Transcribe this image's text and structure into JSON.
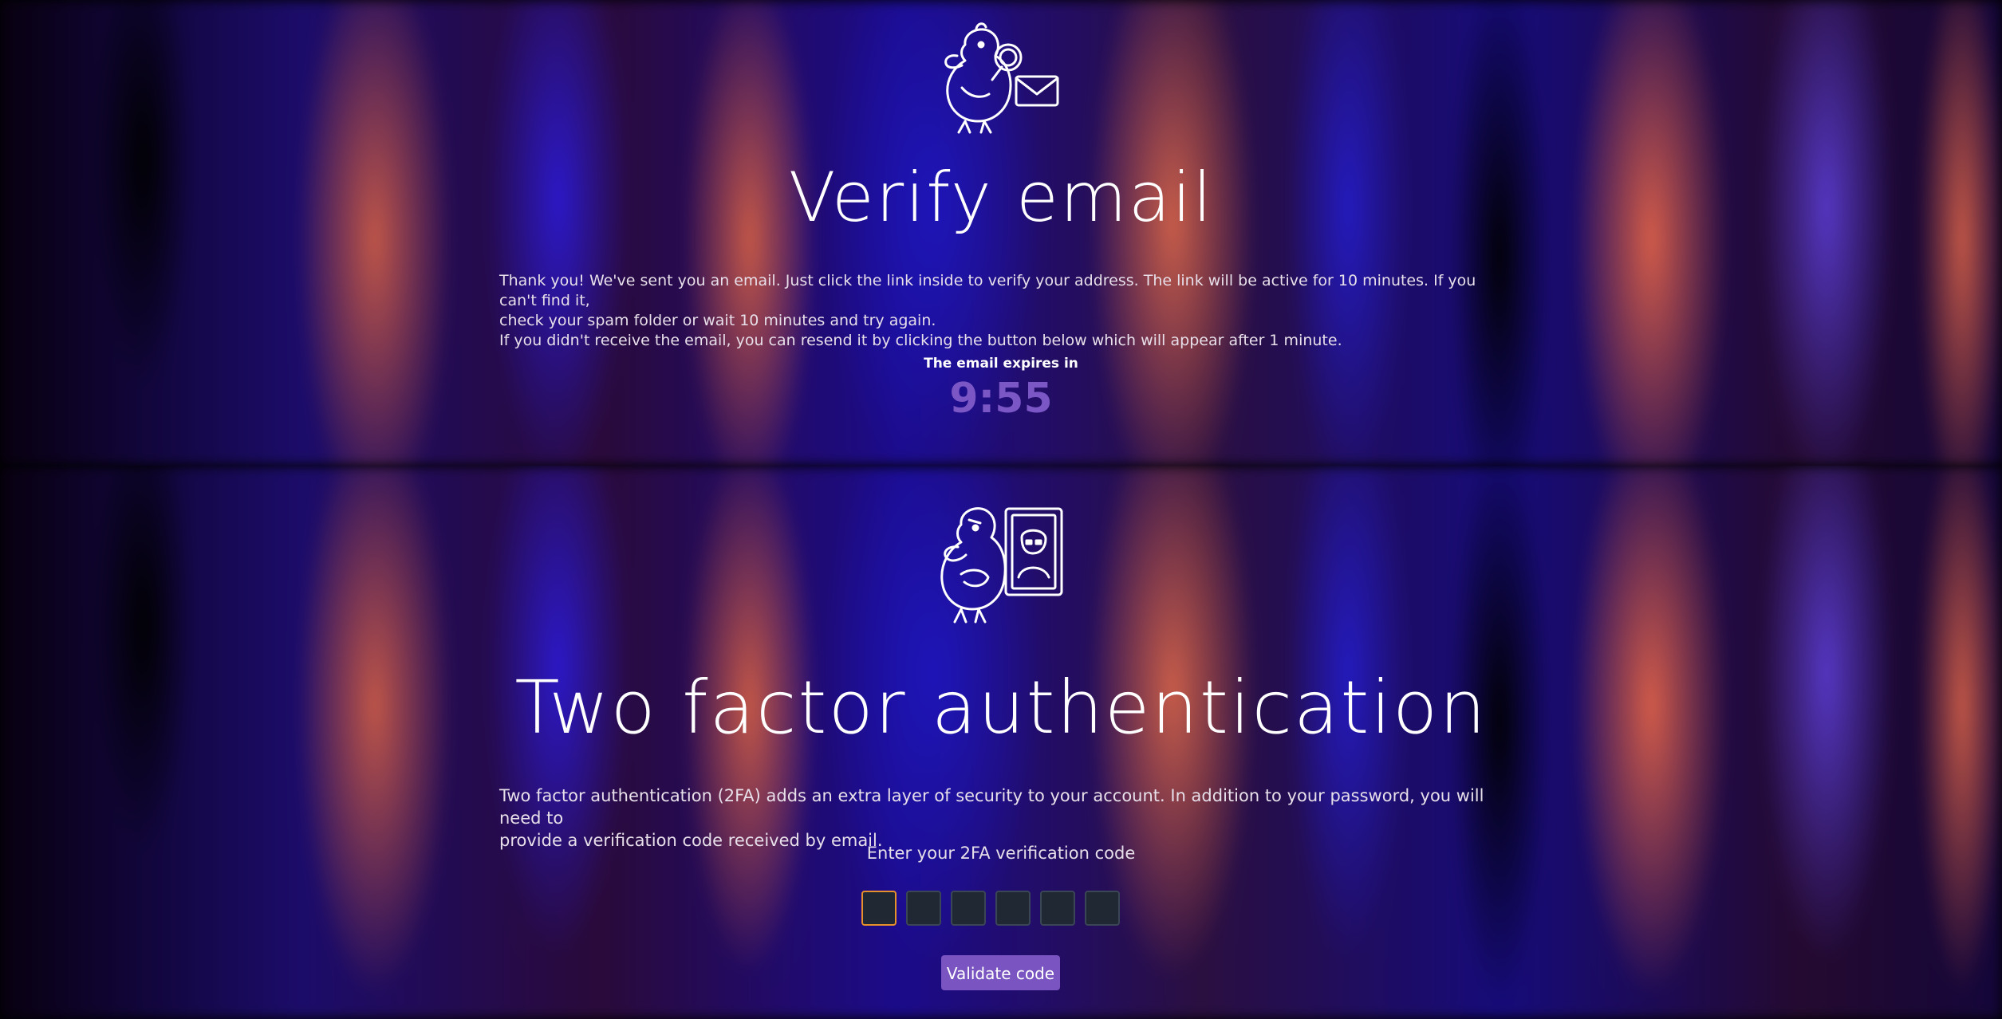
{
  "verify_email": {
    "title": "Verify email",
    "paragraph_line_1": "Thank you! We've sent you an email. Just click the link inside to verify your address. The link will be active for 10 minutes. If you can't find it,",
    "paragraph_line_2": "check your spam folder or wait 10 minutes and try again.",
    "paragraph_line_3": "If you didn't receive the email, you can resend it by clicking the button below which will appear after 1 minute.",
    "expires_label": "The email expires in",
    "timer": "9:55",
    "illustration_icon": "duck-magnifier-envelope-icon"
  },
  "two_factor": {
    "title": "Two factor authentication",
    "paragraph_line_1": "Two factor authentication (2FA) adds an extra layer of security to your account. In addition to your password, you will need to",
    "paragraph_line_2": "provide a verification code received by email.",
    "enter_label": "Enter your 2FA verification code",
    "code_digits": [
      "",
      "",
      "",
      "",
      "",
      ""
    ],
    "validate_button": "Validate code",
    "illustration_icon": "duck-id-card-icon"
  },
  "colors": {
    "accent": "#7a55c1",
    "timer": "#7b57c6",
    "focus_border": "#e8902a",
    "code_box_bg": "#1f2833"
  }
}
